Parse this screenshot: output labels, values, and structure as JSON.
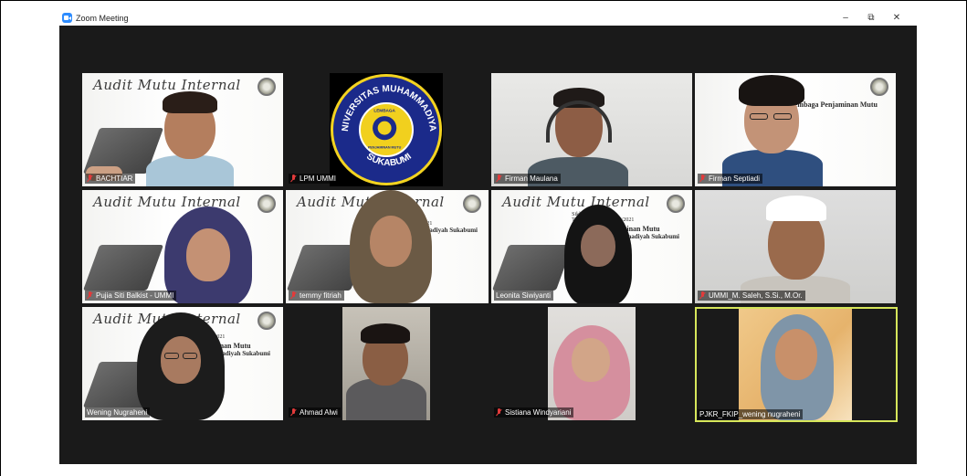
{
  "window": {
    "title": "Zoom Meeting",
    "controls": {
      "minimize": "–",
      "restore": "⧉",
      "close": "✕"
    }
  },
  "slide": {
    "script_title": "Audit Mutu Internal",
    "line1": "Siklus 8",
    "line2": "Tahun Akademik 2020/2021",
    "line3": "Lembaga Penjaminan Mutu",
    "line4": "Universitas Muhammadiyah Sukabumi"
  },
  "logo": {
    "ring_top": "UNIVERSITAS MUHAMMADIYAH",
    "ring_bottom": "SUKABUMI",
    "inner_top": "LEMBAGA",
    "inner_bottom": "PENJAMINAN MUTU"
  },
  "participants": [
    {
      "name": "BACHTIAR",
      "muted": true
    },
    {
      "name": "LPM UMMI",
      "muted": true
    },
    {
      "name": "Firman Maulana",
      "muted": true
    },
    {
      "name": "Firman Septiadi",
      "muted": true
    },
    {
      "name": "Pujia Siti Balkist - UMMI",
      "muted": true
    },
    {
      "name": "temmy fitriah",
      "muted": true
    },
    {
      "name": "Leonita Siwiyanti",
      "muted": false
    },
    {
      "name": "UMMI_M. Saleh, S.Si., M.Or.",
      "muted": true
    },
    {
      "name": "Wening Nugraheni",
      "muted": false
    },
    {
      "name": "Ahmad Alwi",
      "muted": true
    },
    {
      "name": "Sistiana Windyariani",
      "muted": true
    },
    {
      "name": "PJKR_FKIP_wening nugraheni",
      "muted": false
    }
  ],
  "colors": {
    "active_speaker_border": "#d6e65a",
    "muted_icon": "#e23b3b",
    "stage_background": "#1a1a1a"
  }
}
